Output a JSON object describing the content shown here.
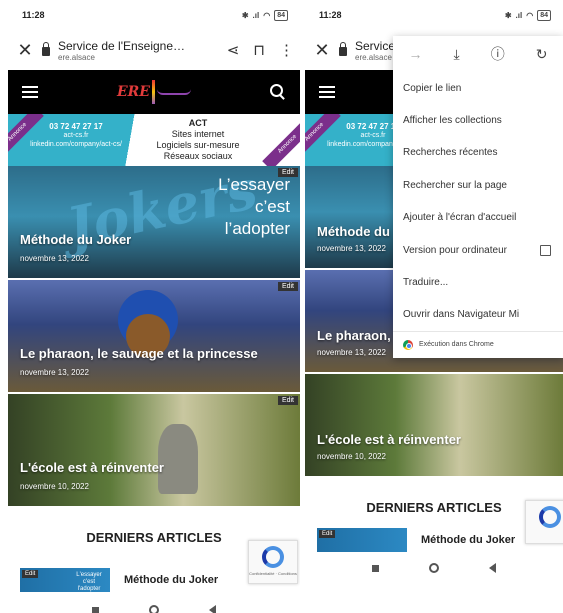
{
  "left": {
    "status": {
      "time": "11:28",
      "battery": "84"
    },
    "urlbar": {
      "title": "Service de l'Enseigne…",
      "domain": "ere.alsace"
    },
    "site": {
      "logo_text": "ERE"
    },
    "ad": {
      "phone": "03 72 47 27 17",
      "site": "act-cs.fr",
      "linkedin": "linkedin.com/company/act-cs/",
      "brand": "ACT",
      "line1": "Sites internet",
      "line2": "Logiciels sur-mesure",
      "line3": "Réseaux sociaux",
      "ribbon": "Annonce"
    },
    "articles": [
      {
        "title": "Méthode du Joker",
        "date": "novembre 13, 2022",
        "edit": "Edit",
        "overlay": "L’essayer\nc’est\nl’adopter",
        "script": "Jokers"
      },
      {
        "title": "Le pharaon, le sauvage et la princesse",
        "date": "novembre 13, 2022",
        "edit": "Edit"
      },
      {
        "title": "L'école est à réinventer",
        "date": "novembre 10, 2022",
        "edit": "Edit"
      }
    ],
    "recent_heading": "DERNIERS ARTICLES",
    "recent_items": [
      {
        "title": "Méthode du Joker",
        "thumb_edit": "Edit",
        "thumb_text": "L'essayer c'est l'adopter"
      }
    ],
    "recaptcha": "Confidentialité · Conditions"
  },
  "right": {
    "status": {
      "time": "11:28",
      "battery": "84"
    },
    "urlbar": {
      "title": "Service",
      "domain": "ere.alsace"
    },
    "menu": {
      "items": [
        "Copier le lien",
        "Afficher les collections",
        "Recherches récentes",
        "Rechercher sur la page",
        "Ajouter à l'écran d'accueil",
        "Version pour ordinateur",
        "Traduire...",
        "Ouvrir dans Navigateur Mi"
      ],
      "footer": "Exécution dans Chrome"
    },
    "articles": [
      {
        "title": "Méthode du",
        "date": "novembre 13, 2022"
      },
      {
        "title": "Le pharaon, l",
        "date": "novembre 13, 2022"
      },
      {
        "title": "L'école est à réinventer",
        "date": "novembre 10, 2022"
      }
    ],
    "recent_heading": "DERNIERS ARTICLES",
    "recent_items": [
      {
        "title": "Méthode du Joker",
        "thumb_edit": "Edit"
      }
    ]
  }
}
